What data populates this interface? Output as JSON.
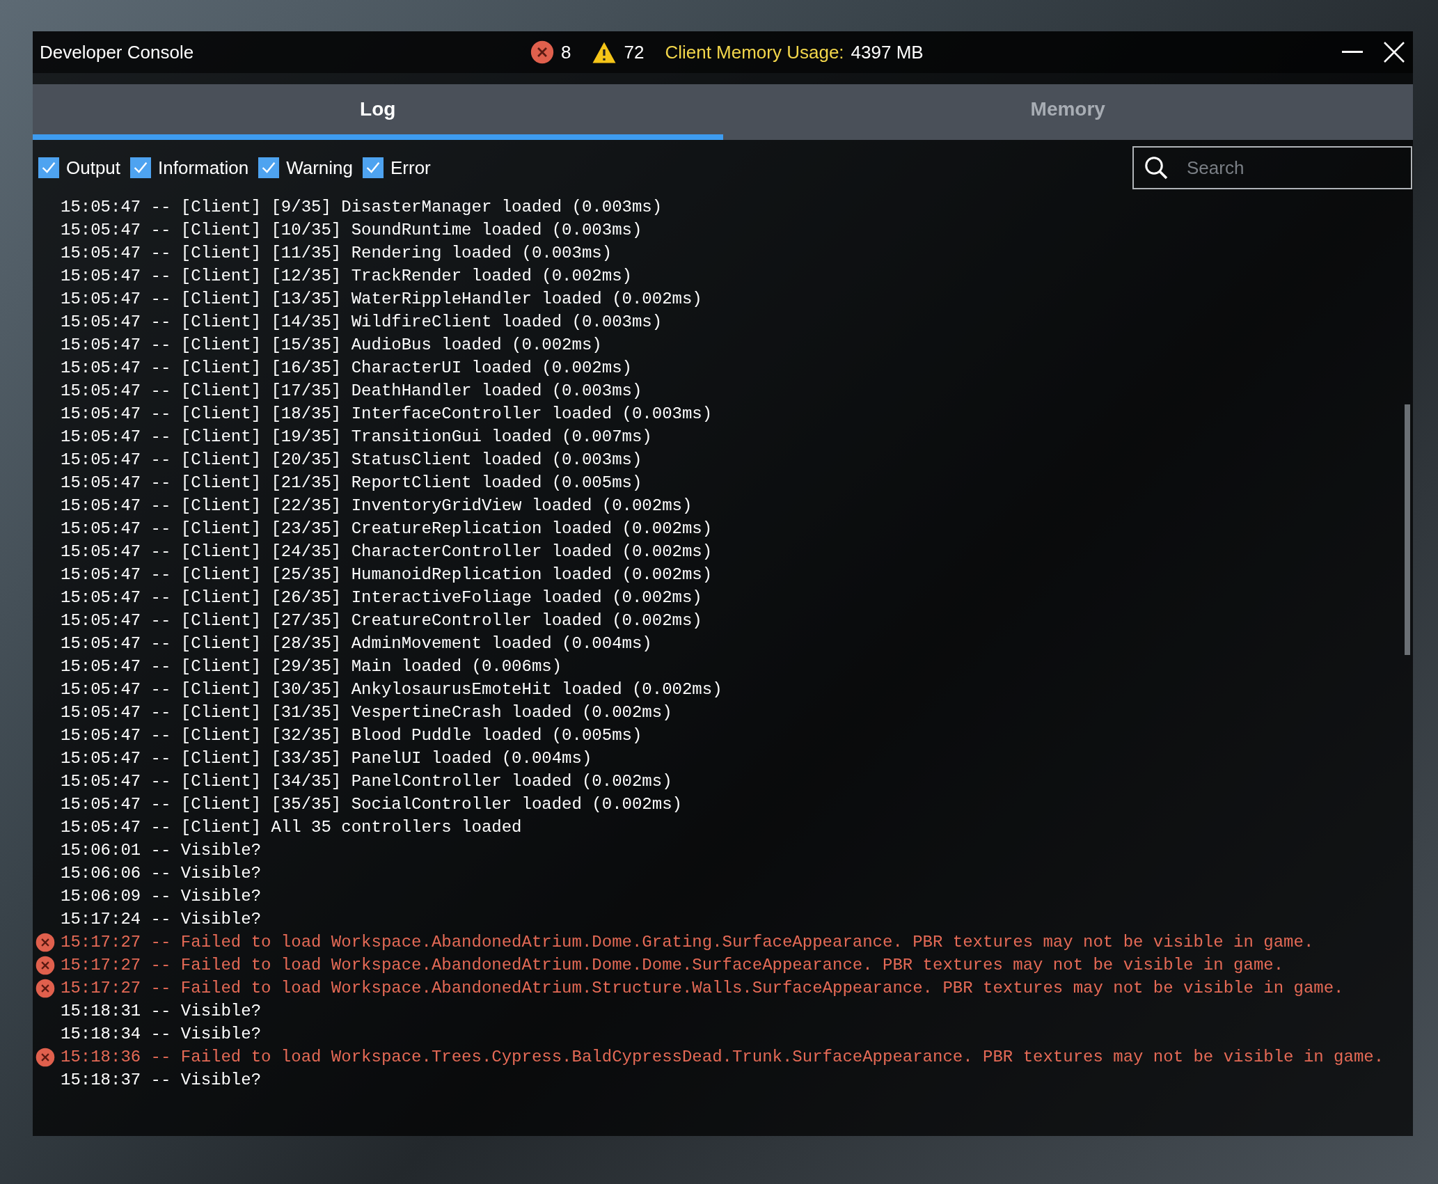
{
  "window": {
    "title": "Developer Console",
    "error_count": "8",
    "warning_count": "72",
    "memory_label": "Client Memory Usage:",
    "memory_value": "4397 MB"
  },
  "tabs": [
    {
      "label": "Log",
      "selected": true
    },
    {
      "label": "Memory",
      "selected": false
    }
  ],
  "filters": [
    {
      "label": "Output",
      "checked": true
    },
    {
      "label": "Information",
      "checked": true
    },
    {
      "label": "Warning",
      "checked": true
    },
    {
      "label": "Error",
      "checked": true
    }
  ],
  "search": {
    "placeholder": "Search"
  },
  "log": [
    {
      "kind": "output",
      "text": "15:05:47 -- [Client] [9/35] DisasterManager loaded (0.003ms)"
    },
    {
      "kind": "output",
      "text": "15:05:47 -- [Client] [10/35] SoundRuntime loaded (0.003ms)"
    },
    {
      "kind": "output",
      "text": "15:05:47 -- [Client] [11/35] Rendering loaded (0.003ms)"
    },
    {
      "kind": "output",
      "text": "15:05:47 -- [Client] [12/35] TrackRender loaded (0.002ms)"
    },
    {
      "kind": "output",
      "text": "15:05:47 -- [Client] [13/35] WaterRippleHandler loaded (0.002ms)"
    },
    {
      "kind": "output",
      "text": "15:05:47 -- [Client] [14/35] WildfireClient loaded (0.003ms)"
    },
    {
      "kind": "output",
      "text": "15:05:47 -- [Client] [15/35] AudioBus loaded (0.002ms)"
    },
    {
      "kind": "output",
      "text": "15:05:47 -- [Client] [16/35] CharacterUI loaded (0.002ms)"
    },
    {
      "kind": "output",
      "text": "15:05:47 -- [Client] [17/35] DeathHandler loaded (0.003ms)"
    },
    {
      "kind": "output",
      "text": "15:05:47 -- [Client] [18/35] InterfaceController loaded (0.003ms)"
    },
    {
      "kind": "output",
      "text": "15:05:47 -- [Client] [19/35] TransitionGui loaded (0.007ms)"
    },
    {
      "kind": "output",
      "text": "15:05:47 -- [Client] [20/35] StatusClient loaded (0.003ms)"
    },
    {
      "kind": "output",
      "text": "15:05:47 -- [Client] [21/35] ReportClient loaded (0.005ms)"
    },
    {
      "kind": "output",
      "text": "15:05:47 -- [Client] [22/35] InventoryGridView loaded (0.002ms)"
    },
    {
      "kind": "output",
      "text": "15:05:47 -- [Client] [23/35] CreatureReplication loaded (0.002ms)"
    },
    {
      "kind": "output",
      "text": "15:05:47 -- [Client] [24/35] CharacterController loaded (0.002ms)"
    },
    {
      "kind": "output",
      "text": "15:05:47 -- [Client] [25/35] HumanoidReplication loaded (0.002ms)"
    },
    {
      "kind": "output",
      "text": "15:05:47 -- [Client] [26/35] InteractiveFoliage loaded (0.002ms)"
    },
    {
      "kind": "output",
      "text": "15:05:47 -- [Client] [27/35] CreatureController loaded (0.002ms)"
    },
    {
      "kind": "output",
      "text": "15:05:47 -- [Client] [28/35] AdminMovement loaded (0.004ms)"
    },
    {
      "kind": "output",
      "text": "15:05:47 -- [Client] [29/35] Main loaded (0.006ms)"
    },
    {
      "kind": "output",
      "text": "15:05:47 -- [Client] [30/35] AnkylosaurusEmoteHit loaded (0.002ms)"
    },
    {
      "kind": "output",
      "text": "15:05:47 -- [Client] [31/35] VespertineCrash loaded (0.002ms)"
    },
    {
      "kind": "output",
      "text": "15:05:47 -- [Client] [32/35] Blood Puddle loaded (0.005ms)"
    },
    {
      "kind": "output",
      "text": "15:05:47 -- [Client] [33/35] PanelUI loaded (0.004ms)"
    },
    {
      "kind": "output",
      "text": "15:05:47 -- [Client] [34/35] PanelController loaded (0.002ms)"
    },
    {
      "kind": "output",
      "text": "15:05:47 -- [Client] [35/35] SocialController loaded (0.002ms)"
    },
    {
      "kind": "output",
      "text": "15:05:47 -- [Client] All 35 controllers loaded"
    },
    {
      "kind": "output",
      "text": "15:06:01 -- Visible?"
    },
    {
      "kind": "output",
      "text": "15:06:06 -- Visible?"
    },
    {
      "kind": "output",
      "text": "15:06:09 -- Visible?"
    },
    {
      "kind": "output",
      "text": "15:17:24 -- Visible?"
    },
    {
      "kind": "error",
      "text": "15:17:27 -- Failed to load Workspace.AbandonedAtrium.Dome.Grating.SurfaceAppearance. PBR textures may not be visible in game."
    },
    {
      "kind": "error",
      "text": "15:17:27 -- Failed to load Workspace.AbandonedAtrium.Dome.Dome.SurfaceAppearance. PBR textures may not be visible in game."
    },
    {
      "kind": "error",
      "text": "15:17:27 -- Failed to load Workspace.AbandonedAtrium.Structure.Walls.SurfaceAppearance. PBR textures may not be visible in game."
    },
    {
      "kind": "output",
      "text": "15:18:31 -- Visible?"
    },
    {
      "kind": "output",
      "text": "15:18:34 -- Visible?"
    },
    {
      "kind": "error",
      "text": "15:18:36 -- Failed to load Workspace.Trees.Cypress.BaldCypressDead.Trunk.SurfaceAppearance. PBR textures may not be visible in game."
    },
    {
      "kind": "output",
      "text": "15:18:37 -- Visible?"
    }
  ]
}
